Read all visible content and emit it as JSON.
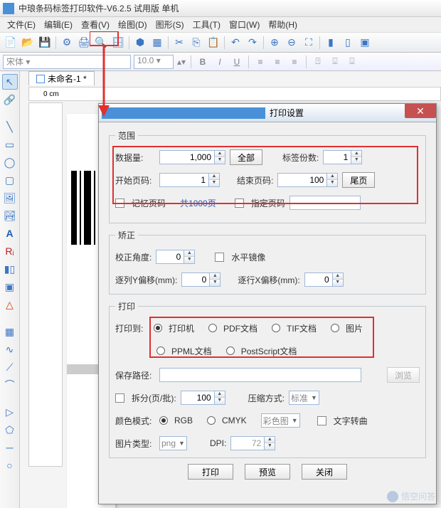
{
  "app": {
    "title": "中琅条码标签打印软件-V6.2.5 试用版 单机"
  },
  "menu": {
    "file": "文件(E)",
    "edit": "编辑(E)",
    "view": "查看(V)",
    "draw": "绘图(D)",
    "shape": "图形(S)",
    "tool": "工具(T)",
    "window": "窗口(W)",
    "help": "帮助(H)"
  },
  "format": {
    "font": "宋体",
    "size": "10.0"
  },
  "doc": {
    "tab": "未命名-1 *",
    "ruler": "0 cm"
  },
  "dialog": {
    "title": "打印设置",
    "range": {
      "legend": "范围",
      "dataCountLabel": "数据量:",
      "dataCount": "1,000",
      "allBtn": "全部",
      "copiesLabel": "标签份数:",
      "copies": "1",
      "startPageLabel": "开始页码:",
      "startPage": "1",
      "endPageLabel": "结束页码:",
      "endPage": "100",
      "lastPageBtn": "尾页",
      "rememberPage": "记忆页码",
      "totalPages": "共1000页",
      "specifyPage": "指定页码"
    },
    "correct": {
      "legend": "矫正",
      "angleLabel": "校正角度:",
      "angle": "0",
      "mirror": "水平镜像",
      "colYLabel": "逐列Y偏移(mm):",
      "colY": "0",
      "rowXLabel": "逐行X偏移(mm):",
      "rowX": "0"
    },
    "print": {
      "legend": "打印",
      "toLabel": "打印到:",
      "printer": "打印机",
      "pdf": "PDF文档",
      "tif": "TIF文档",
      "image": "图片",
      "ppml": "PPML文档",
      "postscript": "PostScript文档",
      "savePathLabel": "保存路径:",
      "browseBtn": "浏览",
      "splitLabel": "拆分(页/批):",
      "split": "100",
      "compressLabel": "压缩方式:",
      "compressVal": "标准",
      "colorModeLabel": "颜色模式:",
      "rgb": "RGB",
      "cmyk": "CMYK",
      "colorSel": "彩色图",
      "textCurve": "文字转曲",
      "imgTypeLabel": "图片类型:",
      "imgType": "png",
      "dpiLabel": "DPI:",
      "dpi": "72"
    },
    "buttons": {
      "print": "打印",
      "preview": "预览",
      "close": "关闭"
    }
  },
  "watermark": "悟空问答"
}
